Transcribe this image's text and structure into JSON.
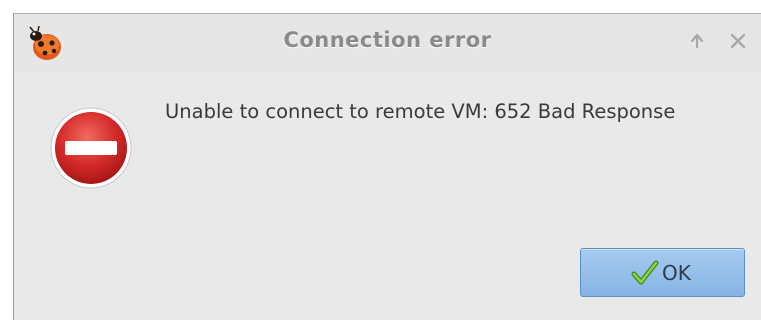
{
  "window": {
    "title": "Connection error",
    "app_icon": "ladybug-icon",
    "controls": {
      "keep_above_icon": "arrow-up-icon",
      "close_icon": "close-icon"
    }
  },
  "content": {
    "icon": "error-no-entry-icon",
    "message": "Unable to connect to remote VM: 652 Bad Response"
  },
  "buttons": {
    "ok_label": "OK",
    "ok_icon": "checkmark-icon"
  },
  "colors": {
    "dialog_bg": "#e9e9e9",
    "error_red": "#d42a2a",
    "button_blue": "#86b4e4",
    "check_green": "#5aa82a"
  }
}
